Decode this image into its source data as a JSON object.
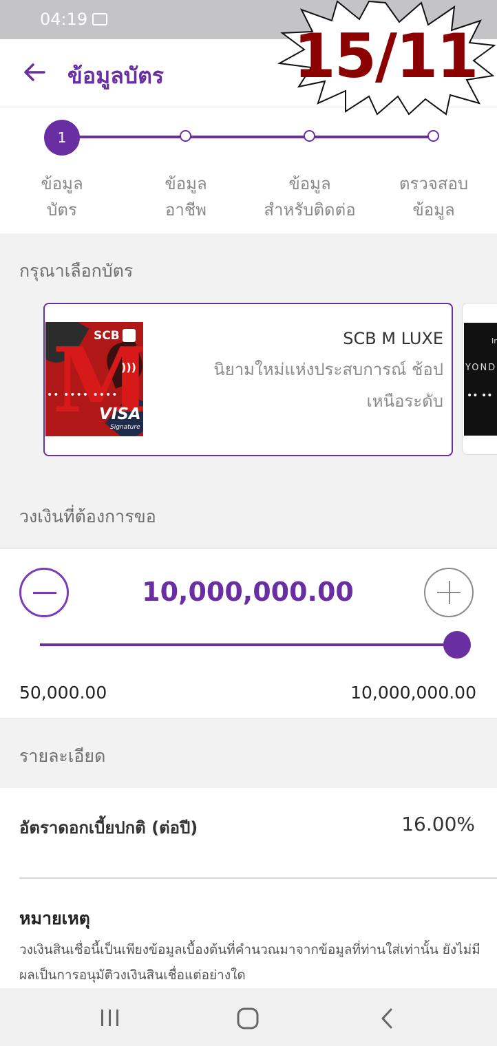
{
  "status_bar": {
    "time": "04:19"
  },
  "header": {
    "title": "ข้อมูลบัตร"
  },
  "overlay": {
    "date_stamp": "15/11"
  },
  "stepper": {
    "active_step": "1",
    "steps": [
      {
        "line1": "ข้อมูล",
        "line2": "บัตร"
      },
      {
        "line1": "ข้อมูล",
        "line2": "อาชีพ"
      },
      {
        "line1": "ข้อมูล",
        "line2": "สำหรับติดต่อ"
      },
      {
        "line1": "ตรวจสอบ",
        "line2": "ข้อมูล"
      }
    ]
  },
  "card_section": {
    "label": "กรุณาเลือกบัตร",
    "selected_card": {
      "name": "SCB M LUXE",
      "description": "นิยามใหม่แห่งประสบการณ์ ช้อปเหนือระดับ",
      "image": {
        "brand": "SCB",
        "number_mask": "•• •••• ••••",
        "network": "VISA",
        "tier": "Signature"
      }
    },
    "next_card": {
      "text1": "In",
      "text2": "YOND",
      "number_mask": "•• ••"
    }
  },
  "amount_section": {
    "label": "วงเงินที่ต้องการขอ",
    "value": "10,000,000.00",
    "min": "50,000.00",
    "max": "10,000,000.00",
    "slider_fraction": 1.0
  },
  "details_section": {
    "label": "รายละเอียด",
    "rate_label": "อัตราดอกเบี้ยปกติ (ต่อปี)",
    "rate_value": "16.00%",
    "note_title": "หมายเหตุ",
    "note_text": "วงเงินสินเชื่อนี้เป็นเพียงข้อมูลเบื้องต้นที่คำนวณมาจากข้อมูลที่ท่านใส่เท่านั้น ยังไม่มีผลเป็นการอนุมัติวงเงินสินเชื่อแต่อย่างใด"
  },
  "colors": {
    "accent": "#6a2ea3",
    "stamp": "#8b0000"
  },
  "icons": [
    "image-icon",
    "back-arrow-icon",
    "minus-icon",
    "plus-icon",
    "recent-apps-icon",
    "home-icon",
    "back-icon"
  ]
}
